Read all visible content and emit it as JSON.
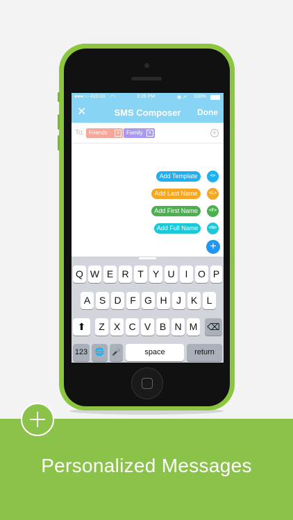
{
  "caption": "Personalized Messages",
  "status_bar": {
    "carrier": "●●●○○ 410-01",
    "time": "3:26 PM",
    "battery": "100%"
  },
  "nav": {
    "close_icon": "close-icon",
    "title": "SMS Composer",
    "done_label": "Done"
  },
  "recipients": {
    "to_label": "To:",
    "chips": [
      {
        "label": "Friends",
        "color": "#f5a89a"
      },
      {
        "label": "Family",
        "color": "#a89bef"
      }
    ],
    "chip_remove_glyph": "×",
    "add_glyph": "+"
  },
  "actions": [
    {
      "label": "Add Template",
      "icon_glyph": "<>",
      "color": "#1eb0f4"
    },
    {
      "label": "Add Last Name",
      "icon_glyph": "<L>",
      "color": "#f5a623"
    },
    {
      "label": "Add First Name",
      "icon_glyph": "<F>",
      "color": "#4caf50"
    },
    {
      "label": "Add Full Name",
      "icon_glyph": "<N>",
      "color": "#1cc8d8"
    }
  ],
  "fab_glyph": "+",
  "keyboard": {
    "row1": [
      "Q",
      "W",
      "E",
      "R",
      "T",
      "Y",
      "U",
      "I",
      "O",
      "P"
    ],
    "row2": [
      "A",
      "S",
      "D",
      "F",
      "G",
      "H",
      "J",
      "K",
      "L"
    ],
    "row3": [
      "Z",
      "X",
      "C",
      "V",
      "B",
      "N",
      "M"
    ],
    "numbers_label": "123",
    "space_label": "space",
    "return_label": "return",
    "shift_glyph": "⬆",
    "delete_glyph": "⌫",
    "globe_glyph": "🌐",
    "mic_glyph": "🎤"
  },
  "colors": {
    "accent_green": "#8bc34a",
    "nav_blue": "#87d4f5",
    "fab_blue": "#2196f3"
  }
}
